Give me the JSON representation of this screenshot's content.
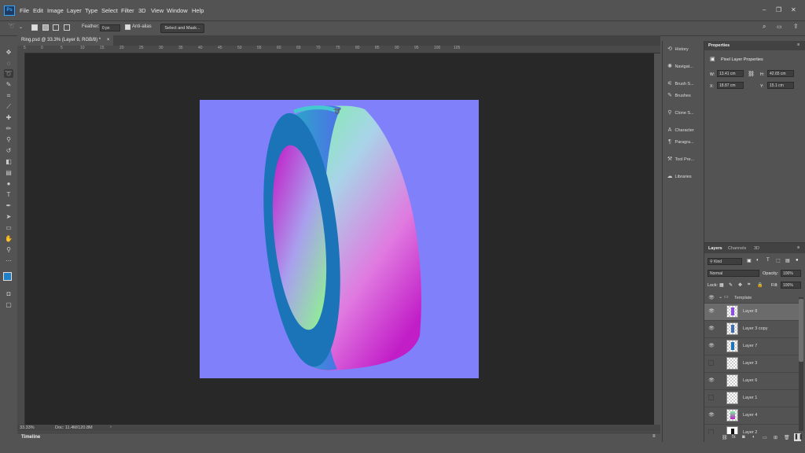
{
  "app": {
    "logo": "Ps"
  },
  "menu": [
    "File",
    "Edit",
    "Image",
    "Layer",
    "Type",
    "Select",
    "Filter",
    "3D",
    "View",
    "Window",
    "Help"
  ],
  "window_controls": {
    "minimize": "–",
    "restore": "❐",
    "close": "✕"
  },
  "options_bar": {
    "feather_label": "Feather:",
    "feather_value": "0 px",
    "antialias_label": "Anti-alias",
    "select_mask_label": "Select and Mask..."
  },
  "document_tab": {
    "title": "Ring.psd @ 33.3% (Layer 8, RGB/8) *",
    "close": "×"
  },
  "ruler_top": [
    "5",
    "0",
    "5",
    "10",
    "15",
    "20",
    "25",
    "30",
    "35",
    "40",
    "45",
    "50",
    "55",
    "60",
    "65",
    "70",
    "75",
    "80",
    "85",
    "90",
    "95",
    "100",
    "105"
  ],
  "status": {
    "zoom": "33.33%",
    "doc": "Doc: 11.4M/120.8M"
  },
  "timeline_label": "Timeline",
  "dock": [
    {
      "icon": "history-icon",
      "label": "History"
    },
    {
      "icon": "navigator-icon",
      "label": "Navigat..."
    },
    {
      "icon": "brush-settings-icon",
      "label": "Brush S..."
    },
    {
      "icon": "brushes-icon",
      "label": "Brushes"
    },
    {
      "icon": "clone-source-icon",
      "label": "Clone S..."
    },
    {
      "icon": "character-icon",
      "label": "Character"
    },
    {
      "icon": "paragraph-icon",
      "label": "Paragra..."
    },
    {
      "icon": "tool-presets-icon",
      "label": "Tool Pre..."
    },
    {
      "icon": "libraries-icon",
      "label": "Libraries"
    }
  ],
  "properties": {
    "tab": "Properties",
    "subtitle": "Pixel Layer Properties",
    "w_label": "W:",
    "w_value": "13.41 cm",
    "h_label": "H:",
    "h_value": "42.65 cm",
    "x_label": "X:",
    "x_value": "18.87 cm",
    "y_label": "Y:",
    "y_value": "15.1 cm"
  },
  "layers_panel": {
    "tabs": [
      "Layers",
      "Channels",
      "3D"
    ],
    "kind": "Kind",
    "blend_mode": "Normal",
    "opacity_label": "Opacity:",
    "opacity_value": "100%",
    "lock_label": "Lock:",
    "fill_label": "Fill:",
    "fill_value": "100%",
    "group_name": "Template",
    "layers": [
      {
        "name": "Layer 8",
        "visible": true,
        "selected": true
      },
      {
        "name": "Layer 3 copy",
        "visible": true,
        "selected": false
      },
      {
        "name": "Layer 7",
        "visible": true,
        "selected": false
      },
      {
        "name": "Layer 3",
        "visible": false,
        "selected": false
      },
      {
        "name": "Layer 6",
        "visible": true,
        "selected": false
      },
      {
        "name": "Layer 1",
        "visible": false,
        "selected": false
      },
      {
        "name": "Layer 4",
        "visible": true,
        "selected": false
      },
      {
        "name": "Layer 2",
        "visible": false,
        "selected": false
      }
    ]
  },
  "colors": {
    "canvas_bg": "#8080fb",
    "accent": "#31a8ff"
  }
}
